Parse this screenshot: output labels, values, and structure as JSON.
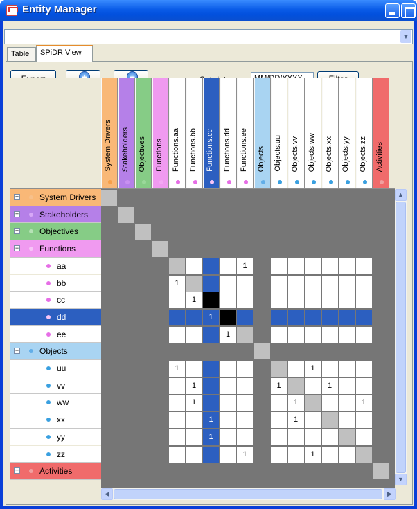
{
  "window": {
    "title": "Entity Manager"
  },
  "tabs": [
    {
      "label": "Table",
      "active": false
    },
    {
      "label": "SPiDR View",
      "active": true
    }
  ],
  "toolbar": {
    "export_label": "Export",
    "set_date_label": "Set date:",
    "date_value": "MM/DD/YYYY",
    "filter_label": "Filter"
  },
  "columns": [
    {
      "label": "System Drivers",
      "color": "#f9b877",
      "dot": "#f7a04a"
    },
    {
      "label": "Stakeholders",
      "color": "#b580e8",
      "dot": "#c890f0"
    },
    {
      "label": "Objectives",
      "color": "#86cc86",
      "dot": "#9ad89a"
    },
    {
      "label": "Functions",
      "color": "#f09af0",
      "dot": "#f4a8f4"
    },
    {
      "label": "Functions.aa",
      "color": "#ffffff",
      "dot": "#e66ee6"
    },
    {
      "label": "Functions.bb",
      "color": "#ffffff",
      "dot": "#e66ee6"
    },
    {
      "label": "Functions.cc",
      "color": "#2c5fc0",
      "dot": "#f4a8f4",
      "selected": true
    },
    {
      "label": "Functions.dd",
      "color": "#ffffff",
      "dot": "#e66ee6"
    },
    {
      "label": "Functions.ee",
      "color": "#ffffff",
      "dot": "#e66ee6"
    },
    {
      "label": "Objects",
      "color": "#a9d4f2",
      "dot": "#62aee8"
    },
    {
      "label": "Objects.uu",
      "color": "#ffffff",
      "dot": "#3aa0e0"
    },
    {
      "label": "Objects.vv",
      "color": "#ffffff",
      "dot": "#3aa0e0"
    },
    {
      "label": "Objects.ww",
      "color": "#ffffff",
      "dot": "#3aa0e0"
    },
    {
      "label": "Objects.xx",
      "color": "#ffffff",
      "dot": "#3aa0e0"
    },
    {
      "label": "Objects.yy",
      "color": "#ffffff",
      "dot": "#3aa0e0"
    },
    {
      "label": "Objects.zz",
      "color": "#ffffff",
      "dot": "#3aa0e0"
    },
    {
      "label": "Activities",
      "color": "#f06b6b",
      "dot": "#f0a0a0"
    }
  ],
  "rows": [
    {
      "label": "System Drivers",
      "type": "group",
      "expanded": false,
      "color": "#f9b877",
      "dot": "#f7c08a"
    },
    {
      "label": "Stakeholders",
      "type": "group",
      "expanded": false,
      "color": "#b580e8",
      "dot": "#d7a8f7"
    },
    {
      "label": "Objectives",
      "type": "group",
      "expanded": false,
      "color": "#86cc86",
      "dot": "#b6e2b6"
    },
    {
      "label": "Functions",
      "type": "group",
      "expanded": true,
      "color": "#f09af0",
      "dot": "#f7c4f7"
    },
    {
      "label": "aa",
      "type": "child",
      "dot": "#e66ee6"
    },
    {
      "label": "bb",
      "type": "child",
      "dot": "#e66ee6"
    },
    {
      "label": "cc",
      "type": "child",
      "dot": "#e66ee6"
    },
    {
      "label": "dd",
      "type": "child",
      "dot": "#f7c4f7",
      "selected": true
    },
    {
      "label": "ee",
      "type": "child",
      "dot": "#e66ee6"
    },
    {
      "label": "Objects",
      "type": "group",
      "expanded": true,
      "color": "#a9d4f2",
      "dot": "#62aee8"
    },
    {
      "label": "uu",
      "type": "child",
      "dot": "#3aa0e0"
    },
    {
      "label": "vv",
      "type": "child",
      "dot": "#3aa0e0"
    },
    {
      "label": "ww",
      "type": "child",
      "dot": "#3aa0e0"
    },
    {
      "label": "xx",
      "type": "child",
      "dot": "#3aa0e0"
    },
    {
      "label": "yy",
      "type": "child",
      "dot": "#3aa0e0"
    },
    {
      "label": "zz",
      "type": "child",
      "dot": "#3aa0e0"
    },
    {
      "label": "Activities",
      "type": "group",
      "expanded": false,
      "color": "#f06b6b",
      "dot": "#f0a0a0"
    }
  ],
  "matrix_values": [
    [
      4,
      8,
      "1"
    ],
    [
      5,
      4,
      "1"
    ],
    [
      6,
      5,
      "1"
    ],
    [
      7,
      6,
      "1"
    ],
    [
      8,
      7,
      "1"
    ],
    [
      10,
      4,
      "1"
    ],
    [
      10,
      12,
      "1"
    ],
    [
      11,
      5,
      "1"
    ],
    [
      11,
      10,
      "1"
    ],
    [
      11,
      13,
      "1"
    ],
    [
      12,
      5,
      "1"
    ],
    [
      12,
      11,
      "1"
    ],
    [
      12,
      15,
      "1"
    ],
    [
      13,
      6,
      "1"
    ],
    [
      13,
      11,
      "1"
    ],
    [
      14,
      6,
      "1"
    ],
    [
      15,
      8,
      "1"
    ],
    [
      15,
      12,
      "1"
    ]
  ],
  "colors": {
    "selection": "#2c5fc0",
    "diagonal": "#c0c0c0",
    "black": "#000000",
    "background": "#767676"
  }
}
